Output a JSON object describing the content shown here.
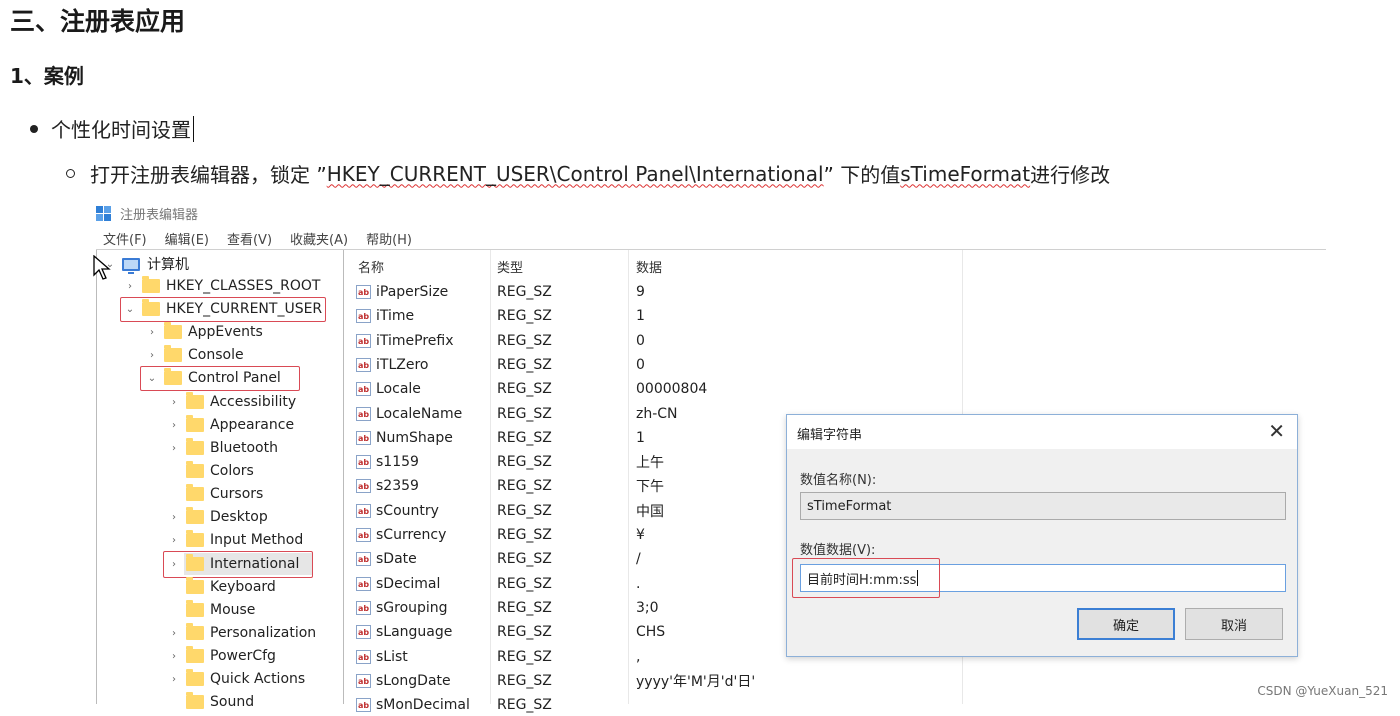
{
  "doc": {
    "h1": "三、注册表应用",
    "h2": "1、案例",
    "bullet1": "个性化时间设置",
    "bullet2": {
      "pre": "打开注册表编辑器，锁定 ”",
      "path": "HKEY_CURRENT_USER\\Control Panel\\International",
      "mid": "” 下的值 ",
      "value": "sTimeFormat",
      "post": " 进行修改"
    }
  },
  "regedit": {
    "title": "注册表编辑器",
    "menu": [
      "文件(F)",
      "编辑(E)",
      "查看(V)",
      "收藏夹(A)",
      "帮助(H)"
    ],
    "tree": {
      "root": "计算机",
      "hkcr": "HKEY_CLASSES_ROOT",
      "hkcu": "HKEY_CURRENT_USER",
      "appevents": "AppEvents",
      "console": "Console",
      "control_panel": "Control Panel",
      "children": [
        "Accessibility",
        "Appearance",
        "Bluetooth",
        "Colors",
        "Cursors",
        "Desktop",
        "Input Method",
        "International",
        "Keyboard",
        "Mouse",
        "Personalization",
        "PowerCfg",
        "Quick Actions",
        "Sound"
      ]
    },
    "columns": {
      "name": "名称",
      "type": "类型",
      "data": "数据"
    },
    "values": [
      {
        "name": "iPaperSize",
        "type": "REG_SZ",
        "data": "9"
      },
      {
        "name": "iTime",
        "type": "REG_SZ",
        "data": "1"
      },
      {
        "name": "iTimePrefix",
        "type": "REG_SZ",
        "data": "0"
      },
      {
        "name": "iTLZero",
        "type": "REG_SZ",
        "data": "0"
      },
      {
        "name": "Locale",
        "type": "REG_SZ",
        "data": "00000804"
      },
      {
        "name": "LocaleName",
        "type": "REG_SZ",
        "data": "zh-CN"
      },
      {
        "name": "NumShape",
        "type": "REG_SZ",
        "data": "1"
      },
      {
        "name": "s1159",
        "type": "REG_SZ",
        "data": "上午"
      },
      {
        "name": "s2359",
        "type": "REG_SZ",
        "data": "下午"
      },
      {
        "name": "sCountry",
        "type": "REG_SZ",
        "data": "中国"
      },
      {
        "name": "sCurrency",
        "type": "REG_SZ",
        "data": "¥"
      },
      {
        "name": "sDate",
        "type": "REG_SZ",
        "data": "/"
      },
      {
        "name": "sDecimal",
        "type": "REG_SZ",
        "data": "."
      },
      {
        "name": "sGrouping",
        "type": "REG_SZ",
        "data": "3;0"
      },
      {
        "name": "sLanguage",
        "type": "REG_SZ",
        "data": "CHS"
      },
      {
        "name": "sList",
        "type": "REG_SZ",
        "data": ","
      },
      {
        "name": "sLongDate",
        "type": "REG_SZ",
        "data": "yyyy'年'M'月'd'日'"
      },
      {
        "name": "sMonDecimal",
        "type": "REG_SZ",
        "data": ""
      }
    ],
    "icon_label": "ab"
  },
  "dialog": {
    "title": "编辑字符串",
    "name_label": "数值名称(N):",
    "name_value": "sTimeFormat",
    "data_label": "数值数据(V):",
    "data_value": "目前时间H:mm:ss",
    "ok": "确定",
    "cancel": "取消"
  },
  "watermark": "CSDN @YueXuan_521"
}
